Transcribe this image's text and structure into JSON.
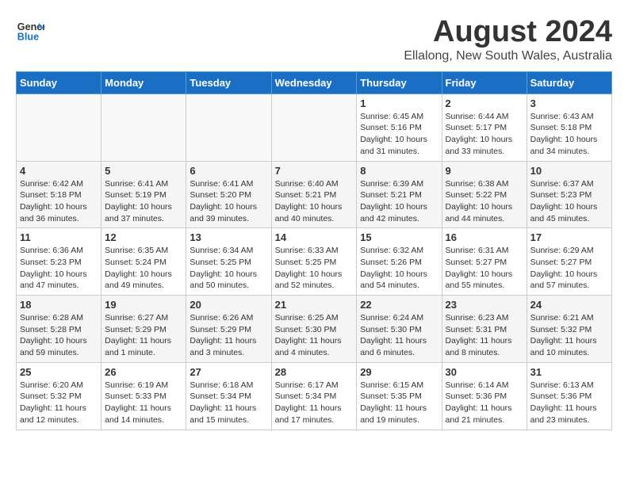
{
  "header": {
    "logo_line1": "General",
    "logo_line2": "Blue",
    "title": "August 2024",
    "subtitle": "Ellalong, New South Wales, Australia"
  },
  "days_of_week": [
    "Sunday",
    "Monday",
    "Tuesday",
    "Wednesday",
    "Thursday",
    "Friday",
    "Saturday"
  ],
  "weeks": [
    [
      {
        "day": "",
        "detail": ""
      },
      {
        "day": "",
        "detail": ""
      },
      {
        "day": "",
        "detail": ""
      },
      {
        "day": "",
        "detail": ""
      },
      {
        "day": "1",
        "detail": "Sunrise: 6:45 AM\nSunset: 5:16 PM\nDaylight: 10 hours\nand 31 minutes."
      },
      {
        "day": "2",
        "detail": "Sunrise: 6:44 AM\nSunset: 5:17 PM\nDaylight: 10 hours\nand 33 minutes."
      },
      {
        "day": "3",
        "detail": "Sunrise: 6:43 AM\nSunset: 5:18 PM\nDaylight: 10 hours\nand 34 minutes."
      }
    ],
    [
      {
        "day": "4",
        "detail": "Sunrise: 6:42 AM\nSunset: 5:18 PM\nDaylight: 10 hours\nand 36 minutes."
      },
      {
        "day": "5",
        "detail": "Sunrise: 6:41 AM\nSunset: 5:19 PM\nDaylight: 10 hours\nand 37 minutes."
      },
      {
        "day": "6",
        "detail": "Sunrise: 6:41 AM\nSunset: 5:20 PM\nDaylight: 10 hours\nand 39 minutes."
      },
      {
        "day": "7",
        "detail": "Sunrise: 6:40 AM\nSunset: 5:21 PM\nDaylight: 10 hours\nand 40 minutes."
      },
      {
        "day": "8",
        "detail": "Sunrise: 6:39 AM\nSunset: 5:21 PM\nDaylight: 10 hours\nand 42 minutes."
      },
      {
        "day": "9",
        "detail": "Sunrise: 6:38 AM\nSunset: 5:22 PM\nDaylight: 10 hours\nand 44 minutes."
      },
      {
        "day": "10",
        "detail": "Sunrise: 6:37 AM\nSunset: 5:23 PM\nDaylight: 10 hours\nand 45 minutes."
      }
    ],
    [
      {
        "day": "11",
        "detail": "Sunrise: 6:36 AM\nSunset: 5:23 PM\nDaylight: 10 hours\nand 47 minutes."
      },
      {
        "day": "12",
        "detail": "Sunrise: 6:35 AM\nSunset: 5:24 PM\nDaylight: 10 hours\nand 49 minutes."
      },
      {
        "day": "13",
        "detail": "Sunrise: 6:34 AM\nSunset: 5:25 PM\nDaylight: 10 hours\nand 50 minutes."
      },
      {
        "day": "14",
        "detail": "Sunrise: 6:33 AM\nSunset: 5:25 PM\nDaylight: 10 hours\nand 52 minutes."
      },
      {
        "day": "15",
        "detail": "Sunrise: 6:32 AM\nSunset: 5:26 PM\nDaylight: 10 hours\nand 54 minutes."
      },
      {
        "day": "16",
        "detail": "Sunrise: 6:31 AM\nSunset: 5:27 PM\nDaylight: 10 hours\nand 55 minutes."
      },
      {
        "day": "17",
        "detail": "Sunrise: 6:29 AM\nSunset: 5:27 PM\nDaylight: 10 hours\nand 57 minutes."
      }
    ],
    [
      {
        "day": "18",
        "detail": "Sunrise: 6:28 AM\nSunset: 5:28 PM\nDaylight: 10 hours\nand 59 minutes."
      },
      {
        "day": "19",
        "detail": "Sunrise: 6:27 AM\nSunset: 5:29 PM\nDaylight: 11 hours\nand 1 minute."
      },
      {
        "day": "20",
        "detail": "Sunrise: 6:26 AM\nSunset: 5:29 PM\nDaylight: 11 hours\nand 3 minutes."
      },
      {
        "day": "21",
        "detail": "Sunrise: 6:25 AM\nSunset: 5:30 PM\nDaylight: 11 hours\nand 4 minutes."
      },
      {
        "day": "22",
        "detail": "Sunrise: 6:24 AM\nSunset: 5:30 PM\nDaylight: 11 hours\nand 6 minutes."
      },
      {
        "day": "23",
        "detail": "Sunrise: 6:23 AM\nSunset: 5:31 PM\nDaylight: 11 hours\nand 8 minutes."
      },
      {
        "day": "24",
        "detail": "Sunrise: 6:21 AM\nSunset: 5:32 PM\nDaylight: 11 hours\nand 10 minutes."
      }
    ],
    [
      {
        "day": "25",
        "detail": "Sunrise: 6:20 AM\nSunset: 5:32 PM\nDaylight: 11 hours\nand 12 minutes."
      },
      {
        "day": "26",
        "detail": "Sunrise: 6:19 AM\nSunset: 5:33 PM\nDaylight: 11 hours\nand 14 minutes."
      },
      {
        "day": "27",
        "detail": "Sunrise: 6:18 AM\nSunset: 5:34 PM\nDaylight: 11 hours\nand 15 minutes."
      },
      {
        "day": "28",
        "detail": "Sunrise: 6:17 AM\nSunset: 5:34 PM\nDaylight: 11 hours\nand 17 minutes."
      },
      {
        "day": "29",
        "detail": "Sunrise: 6:15 AM\nSunset: 5:35 PM\nDaylight: 11 hours\nand 19 minutes."
      },
      {
        "day": "30",
        "detail": "Sunrise: 6:14 AM\nSunset: 5:36 PM\nDaylight: 11 hours\nand 21 minutes."
      },
      {
        "day": "31",
        "detail": "Sunrise: 6:13 AM\nSunset: 5:36 PM\nDaylight: 11 hours\nand 23 minutes."
      }
    ]
  ]
}
